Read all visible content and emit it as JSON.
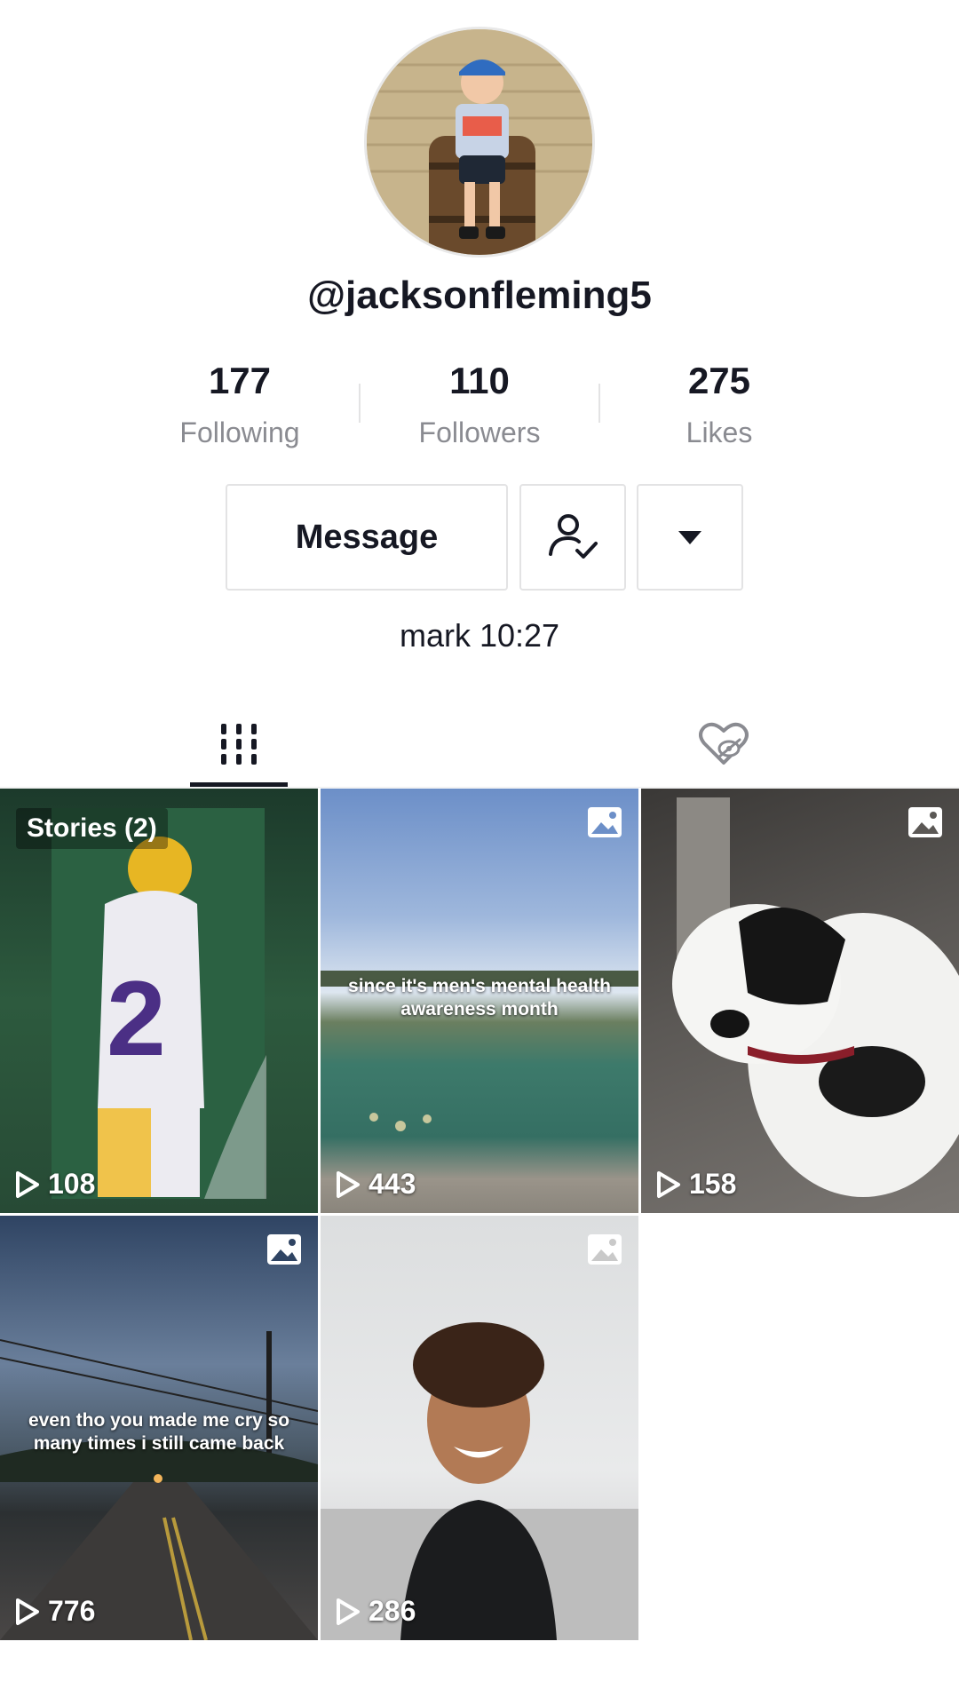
{
  "profile": {
    "username": "@jacksonfleming5",
    "bio": "mark 10:27"
  },
  "stats": [
    {
      "value": "177",
      "label": "Following"
    },
    {
      "value": "110",
      "label": "Followers"
    },
    {
      "value": "275",
      "label": "Likes"
    }
  ],
  "actions": {
    "message_label": "Message",
    "following_icon": "person-check-icon",
    "more_icon": "caret-down-icon"
  },
  "tabs": {
    "videos_icon": "grid-icon",
    "liked_icon": "hidden-heart-icon",
    "active": "videos"
  },
  "videos": [
    {
      "views": "108",
      "stories_label": "Stories (2)",
      "caption": "",
      "photo": false
    },
    {
      "views": "443",
      "caption": "since it's men's mental health awareness month",
      "photo": true
    },
    {
      "views": "158",
      "caption": "",
      "photo": true
    },
    {
      "views": "776",
      "caption": "even tho you made me cry so many times i still came back",
      "photo": true
    },
    {
      "views": "286",
      "caption": "",
      "photo": true
    }
  ],
  "colors": {
    "text": "#161823",
    "muted": "#8a8b91",
    "border": "#e3e3e4"
  }
}
